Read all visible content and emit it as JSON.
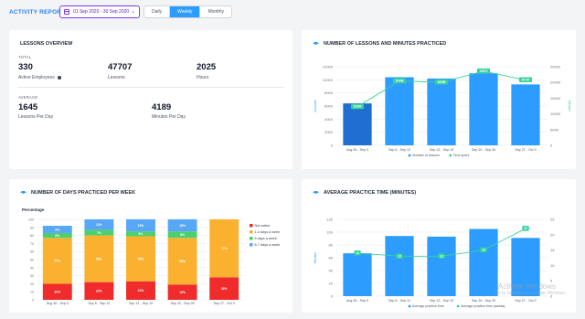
{
  "header": {
    "title": "ACTIVITY REPORTS",
    "date_range": "01 Sep 2020 - 30 Sep 2020",
    "periods": [
      "Daily",
      "Weekly",
      "Monthly"
    ],
    "active_period": "Weekly"
  },
  "overview": {
    "title": "LESSONS OVERVIEW",
    "total_label": "TOTAL",
    "totals": [
      {
        "value": "330",
        "label": "Active Employees"
      },
      {
        "value": "47707",
        "label": "Lessons"
      },
      {
        "value": "2025",
        "label": "Hours"
      }
    ],
    "average_label": "AVERAGE",
    "averages": [
      {
        "value": "1645",
        "label": "Lessons Per Day"
      },
      {
        "value": "4189",
        "label": "Minutes Per Day"
      }
    ]
  },
  "colors": {
    "accent": "#2d9cff",
    "bar_blue": "#2d9cff",
    "bar_dark": "#1e6fd0",
    "line_green": "#34d399",
    "not_active": "#ef2b2b",
    "one_four": "#fbb130",
    "five_days": "#4ccf6d",
    "six_seven": "#58a7f7"
  },
  "chart_data": [
    {
      "type": "bar",
      "title": "NUMBER OF LESSONS AND MINUTES PRACTICED",
      "categories": [
        "Aug 30 - Sep 5",
        "Sep 6 - Sep 12",
        "Sep 13 - Sep 19",
        "Sep 20 - Sep 26",
        "Sep 27 - Oct 3"
      ],
      "series": [
        {
          "name": "Number of lessons",
          "type": "bar",
          "values": [
            6400,
            10400,
            10200,
            11000,
            9300
          ]
        },
        {
          "name": "Time spent",
          "type": "line",
          "axis": "right",
          "values": [
            12300,
            20448,
            20058,
            23573,
            20767
          ],
          "labels": [
            "12300",
            "20448",
            "20058",
            "23573",
            "20767"
          ]
        }
      ],
      "ylim": [
        0,
        12000
      ],
      "yticks": [
        "0",
        "2000",
        "4000",
        "6000",
        "8000",
        "10000",
        "12000"
      ],
      "y2lim": [
        0,
        25000
      ],
      "y2ticks": [
        "0",
        "5000",
        "10000",
        "15000",
        "20000",
        "25000"
      ],
      "ylabel": "Lessons",
      "y2label": "Minutes"
    },
    {
      "type": "bar",
      "stacked": true,
      "title": "NUMBER OF DAYS PRACTICED PER WEEK",
      "ylabel": "Percentage",
      "categories": [
        "Aug 30 - Sep 5",
        "Sep 6 - Sep 12",
        "Sep 13 - Sep 19",
        "Sep 20 - Sep 26",
        "Sep 27 - Oct 3"
      ],
      "series": [
        {
          "name": "Not active",
          "values": [
            20,
            22,
            23,
            19,
            28
          ]
        },
        {
          "name": "1-4 days a week",
          "values": [
            57,
            58,
            56,
            58,
            72
          ]
        },
        {
          "name": "5 days a week",
          "values": [
            6,
            7,
            6,
            8,
            0
          ]
        },
        {
          "name": "6-7 days a week",
          "values": [
            9,
            13,
            15,
            15,
            0
          ]
        }
      ],
      "data_labels": [
        [
          "20%",
          "57%",
          "8%",
          "9%"
        ],
        [
          "22%",
          "58%",
          "7%",
          "13%"
        ],
        [
          "23%",
          "56%",
          "6%",
          "15%"
        ],
        [
          "19%",
          "58%",
          "8%",
          "15%"
        ],
        [
          "28%",
          "72%",
          "",
          ""
        ]
      ],
      "ylim": [
        0,
        100
      ],
      "yticks": [
        "0",
        "10",
        "20",
        "30",
        "40",
        "50",
        "60",
        "70",
        "80",
        "90",
        "100"
      ]
    },
    {
      "type": "bar",
      "title": "AVERAGE PRACTICE TIME (MINUTES)",
      "categories": [
        "Aug 30 - Sep 5",
        "Sep 6 - Sep 12",
        "Sep 13 - Sep 19",
        "Sep 20 - Sep 26",
        "Sep 27 - Oct 3"
      ],
      "series": [
        {
          "name": "Average practice time",
          "type": "bar",
          "values": [
            67,
            94,
            93,
            105,
            91
          ]
        },
        {
          "name": "Average practice time pastday",
          "type": "line",
          "axis": "right",
          "values": [
            14,
            13,
            13,
            15,
            22
          ],
          "labels": [
            "14",
            "13",
            "13",
            "15",
            "22"
          ]
        }
      ],
      "ylim": [
        0,
        120
      ],
      "yticks": [
        "0",
        "20",
        "40",
        "60",
        "80",
        "100",
        "120"
      ],
      "y2lim": [
        0,
        25
      ],
      "y2ticks": [
        "0",
        "5",
        "10",
        "15",
        "20",
        "25"
      ],
      "ylabel": "Minutes"
    }
  ],
  "watermark": {
    "line1": "Activate Windows",
    "line2": "Go to Settings to activate Windows."
  }
}
